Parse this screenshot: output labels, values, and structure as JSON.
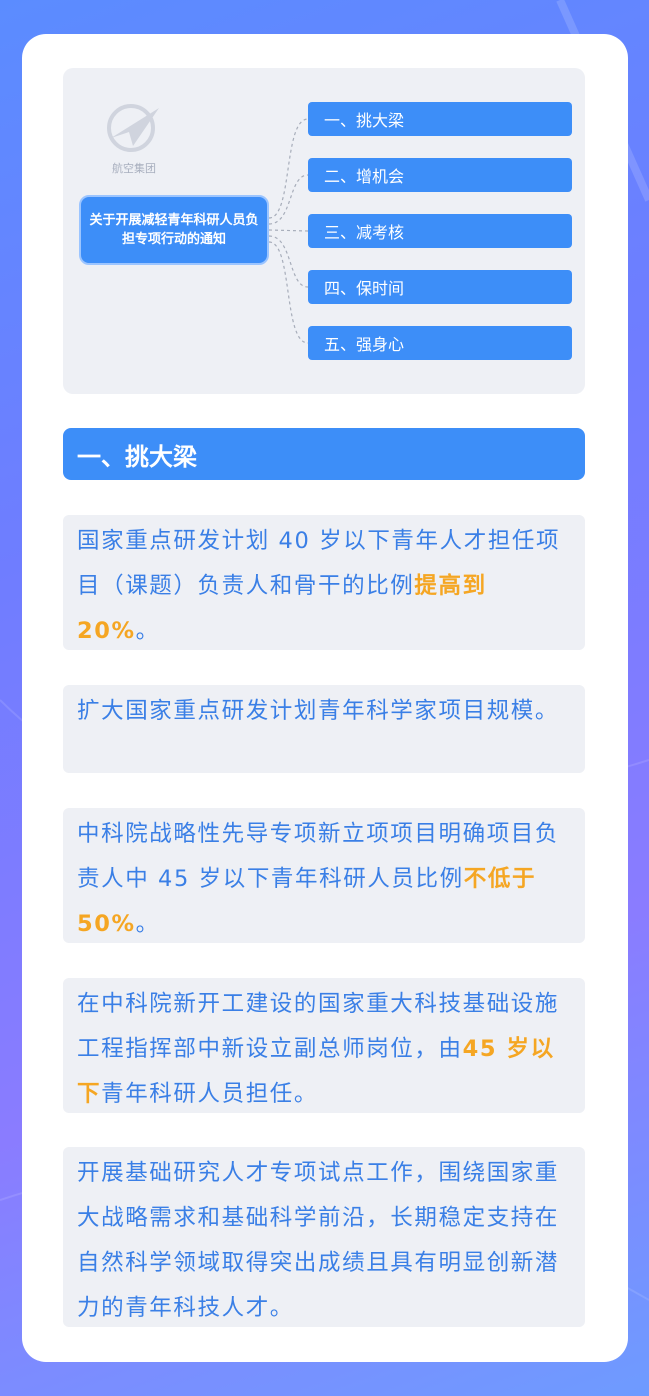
{
  "mindmap": {
    "logo_text": "航空集团",
    "center": "关于开展减轻青年科研人员负担专项行动的通知",
    "branches": [
      "一、挑大梁",
      "二、增机会",
      "三、减考核",
      "四、保时间",
      "五、强身心"
    ]
  },
  "section": {
    "title": "一、挑大梁"
  },
  "paragraphs": {
    "p1": {
      "a": "国家重点研发计划 40 岁以下青年人才担任项目（课题）负责人和骨干的比例",
      "hl": "提高到 20%",
      "b": "。"
    },
    "p2": {
      "a": "扩大国家重点研发计划青年科学家项目规模。"
    },
    "p3": {
      "a": "中科院战略性先导专项新立项项目明确项目负责人中 45 岁以下青年科研人员比例",
      "hl": "不低于 50%",
      "b": "。"
    },
    "p4": {
      "a": "在中科院新开工建设的国家重大科技基础设施工程指挥部中新设立副总师岗位，由",
      "hl": "45 岁以下",
      "b": "青年科研人员担任。"
    },
    "p5": {
      "a": "开展基础研究人才专项试点工作，围绕国家重大战略需求和基础科学前沿，长期稳定支持在自然科学领域取得突出成绩且具有明显创新潜力的青年科技人才。"
    }
  },
  "colors": {
    "accent": "#3d8ef8",
    "highlight": "#f5a623",
    "text": "#3a7fe6",
    "panel": "#eef0f5"
  }
}
